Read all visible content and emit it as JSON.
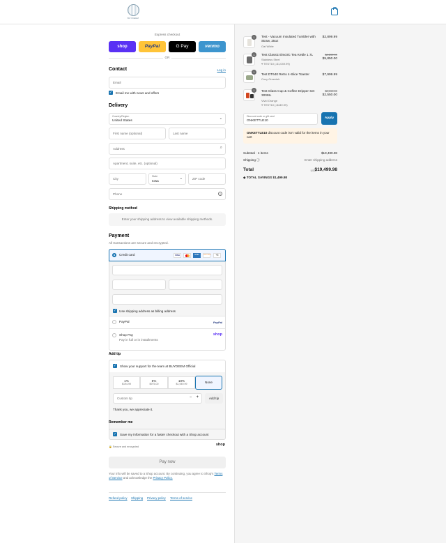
{
  "header": {
    "logo_text": "BUYDEEM",
    "cart_icon": "shopping-bag-icon"
  },
  "express": {
    "title": "Express checkout",
    "buttons": [
      "shop",
      "PayPal",
      "G Pay",
      "venmo"
    ],
    "or": "OR"
  },
  "contact": {
    "title": "Contact",
    "login": "Log in",
    "email_placeholder": "Email",
    "newsletter": "Email me with news and offers"
  },
  "delivery": {
    "title": "Delivery",
    "country_label": "Country/Region",
    "country_value": "United States",
    "first_name": "First name (optional)",
    "last_name": "Last name",
    "address": "Address",
    "apartment": "Apartment, suite, etc. (optional)",
    "city": "City",
    "state_label": "State",
    "state_value": "Iowa",
    "zip": "ZIP code",
    "phone": "Phone"
  },
  "shipping": {
    "title": "Shipping method",
    "message": "Enter your shipping address to view available shipping methods."
  },
  "payment": {
    "title": "Payment",
    "subtitle": "All transactions are secure and encrypted.",
    "credit_card": "Credit card",
    "card_brands": [
      "VISA",
      "MC",
      "AMEX",
      "DISCOVER"
    ],
    "more": "+5",
    "billing": "Use shipping address as billing address",
    "paypal": "PayPal",
    "paypal_logo": "PayPal",
    "shop_pay": "Shop Pay",
    "shop_pay_sub": "Pay in full or in installments",
    "shop_logo": "shop"
  },
  "tip": {
    "title": "Add tip",
    "support": "Show your support for the team at BUYDEEM Official",
    "options": [
      {
        "pct": "1%",
        "amt": "$194.99"
      },
      {
        "pct": "5%",
        "amt": "$975.00"
      },
      {
        "pct": "10%",
        "amt": "$1,949.99"
      },
      {
        "pct": "None",
        "amt": ""
      }
    ],
    "custom": "Custom tip",
    "add": "Add tip",
    "thanks": "Thank you, we appreciate it."
  },
  "remember": {
    "title": "Remember me",
    "save": "Save my information for a faster checkout with a Shop account",
    "secure": "Secure and encrypted",
    "shop": "shop"
  },
  "pay_now": "Pay now",
  "legal": {
    "line1": "Your info will be saved to a Shop account. By continuing, you agree to Shop's",
    "tos": "Terms of Service",
    "and": "and acknowledge the",
    "privacy": "Privacy Policy."
  },
  "footer": [
    "Refund policy",
    "Shipping",
    "Privacy policy",
    "Terms of service"
  ],
  "summary": {
    "items": [
      {
        "qty": "1",
        "name1": "Test - Vacuum Insulated Tumbler with",
        "name2": "Straw, 25oz",
        "variant": "Oat White",
        "discount": "",
        "old": "",
        "price": "$2,899.99"
      },
      {
        "qty": "1",
        "name1": "Test Classic Electric Tea Kettle 1.7L",
        "name2": "",
        "variant": "Stainless Steel",
        "discount": "TEST10 (-$1,049.99)",
        "old": "$6,899.99",
        "price": "$5,850.00"
      },
      {
        "qty": "1",
        "name1": "Test DT640 Retro 4-Slice Toaster",
        "name2": "",
        "variant": "Cozy Greenish",
        "discount": "",
        "old": "",
        "price": "$7,999.99"
      },
      {
        "qty": "1",
        "name1": "Test Glass Cup & Coffee Dripper Set",
        "name2": "300ML",
        "variant": "Vivid Orange",
        "discount": "TEST10 (-$449.99)",
        "old": "$2,999.99",
        "price": "$2,550.00"
      }
    ],
    "code_label": "Discount code or gift card",
    "code_value": "GNKETTLE10",
    "apply": "Apply",
    "error_code": "GNKETTLE10",
    "error_text": "discount code isn't valid for the items in your cart",
    "subtotal_label": "Subtotal · 4 items",
    "subtotal": "$19,499.98",
    "shipping_label": "Shipping",
    "shipping_value": "Enter shipping address",
    "total_label": "Total",
    "currency": "USD",
    "total": "$19,499.98",
    "savings_label": "TOTAL SAVINGS",
    "savings": "$1,499.98"
  }
}
